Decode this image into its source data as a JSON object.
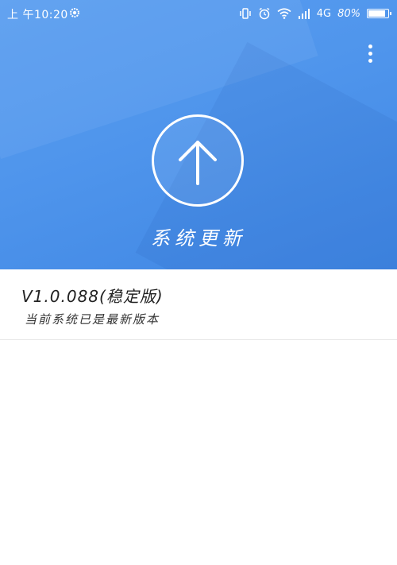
{
  "status_bar": {
    "time": "上 午10:20",
    "network": "4G",
    "battery_percent": "80%",
    "battery_level": 0.8,
    "icons": [
      "settings-gear-icon",
      "vibrate-icon",
      "alarm-icon",
      "wifi-icon",
      "signal-icon",
      "battery-icon"
    ]
  },
  "header": {
    "menu_icon": "more-vert-icon",
    "update_icon": "arrow-up-icon",
    "title": "系统更新"
  },
  "version_info": {
    "version": "V1.0.088(稳定版)",
    "status": "当前系统已是最新版本"
  },
  "colors": {
    "hero_blue": "#4f95ec",
    "white": "#ffffff",
    "divider": "#e6e6e6"
  }
}
